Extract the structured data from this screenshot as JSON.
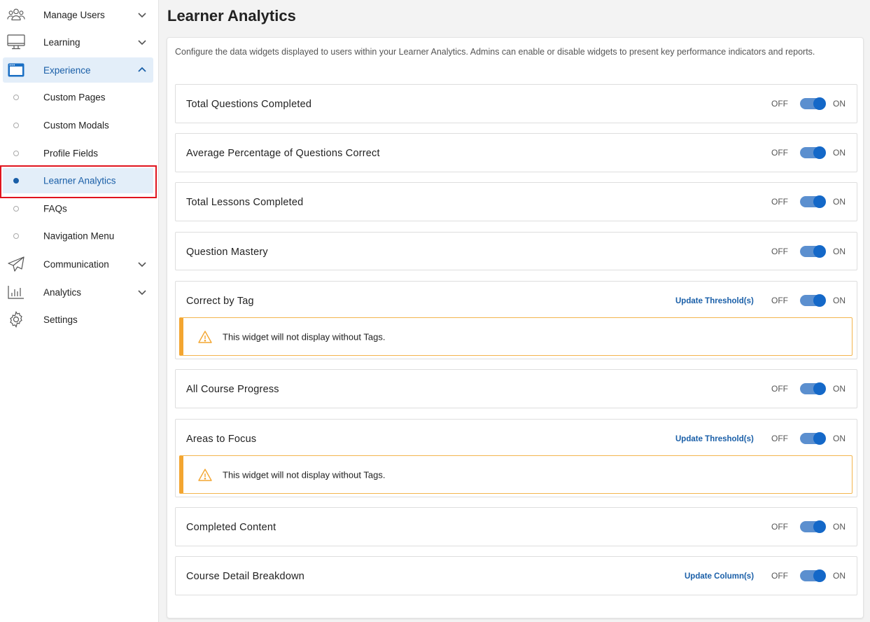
{
  "sidebar": {
    "items": [
      {
        "label": "Manage Users",
        "icon": "users-icon"
      },
      {
        "label": "Learning",
        "icon": "monitor-icon"
      },
      {
        "label": "Experience",
        "icon": "browser-window-icon"
      },
      {
        "label": "Communication",
        "icon": "paper-plane-icon"
      },
      {
        "label": "Analytics",
        "icon": "bar-chart-icon"
      },
      {
        "label": "Settings",
        "icon": "gear-icon"
      }
    ],
    "experience_subitems": [
      {
        "label": "Custom Pages"
      },
      {
        "label": "Custom Modals"
      },
      {
        "label": "Profile Fields"
      },
      {
        "label": "Learner Analytics",
        "active": true
      },
      {
        "label": "FAQs"
      },
      {
        "label": "Navigation Menu"
      }
    ]
  },
  "main": {
    "title": "Learner Analytics",
    "description": "Configure the data widgets displayed to users within your Learner Analytics. Admins can enable or disable widgets to present key performance indicators and reports.",
    "off_label": "OFF",
    "on_label": "ON",
    "widgets": [
      {
        "name": "Total Questions Completed",
        "enabled": true
      },
      {
        "name": "Average Percentage of Questions Correct",
        "enabled": true
      },
      {
        "name": "Total Lessons Completed",
        "enabled": true
      },
      {
        "name": "Question Mastery",
        "enabled": true
      },
      {
        "name": "Correct by Tag",
        "enabled": true,
        "link": "Update Threshold(s)",
        "warning": "This widget will not display without Tags."
      },
      {
        "name": "All Course Progress",
        "enabled": true
      },
      {
        "name": "Areas to Focus",
        "enabled": true,
        "link": "Update Threshold(s)",
        "warning": "This widget will not display without Tags."
      },
      {
        "name": "Completed Content",
        "enabled": true
      },
      {
        "name": "Course Detail Breakdown",
        "enabled": true,
        "link": "Update Column(s)"
      }
    ]
  },
  "colors": {
    "accent": "#1a5fa8",
    "toggle_track": "#5b8fcf",
    "toggle_knob": "#1468c8",
    "active_bg": "#e3eef9",
    "warning": "#f3a530",
    "highlight": "#e0141e"
  }
}
